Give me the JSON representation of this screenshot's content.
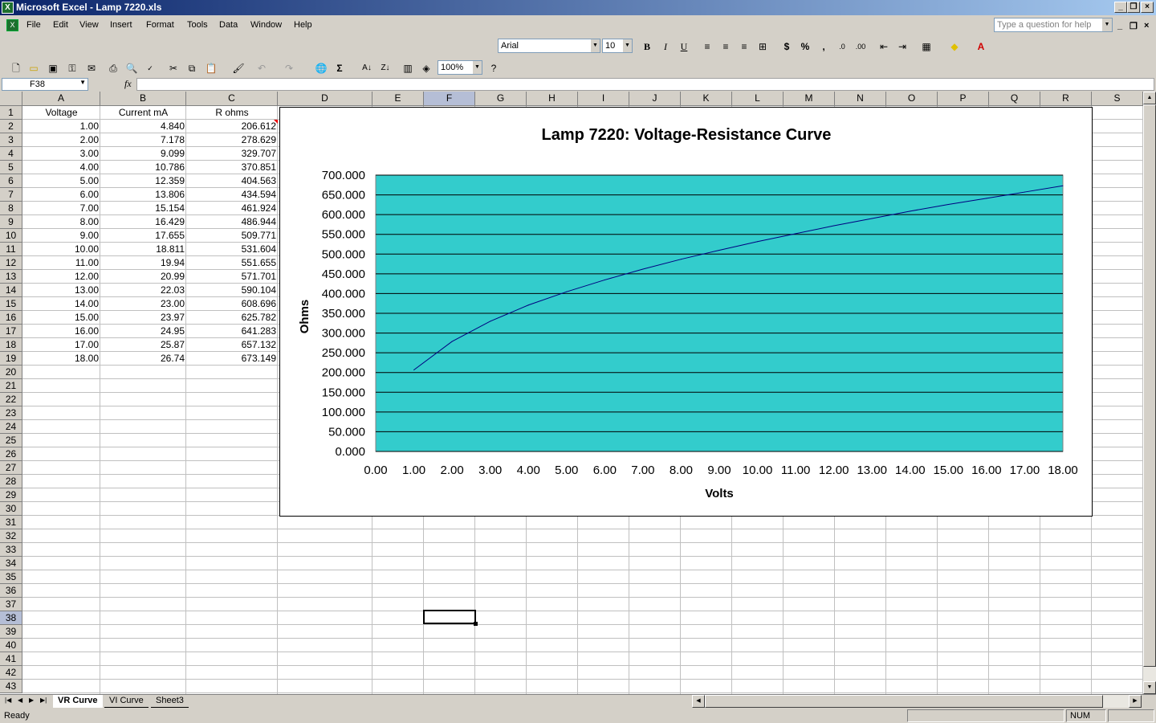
{
  "window": {
    "title": "Microsoft Excel - Lamp 7220.xls"
  },
  "menu": {
    "items": [
      "File",
      "Edit",
      "View",
      "Insert",
      "Format",
      "Tools",
      "Data",
      "Window",
      "Help"
    ],
    "help_placeholder": "Type a question for help"
  },
  "format_toolbar": {
    "font": "Arial",
    "size": "10"
  },
  "standard_toolbar": {
    "zoom": "100%"
  },
  "formula_bar": {
    "name_box": "F38",
    "fx": "fx",
    "formula": ""
  },
  "columns": [
    "A",
    "B",
    "C",
    "D",
    "E",
    "F",
    "G",
    "H",
    "I",
    "J",
    "K",
    "L",
    "M",
    "N",
    "O",
    "P",
    "Q",
    "R",
    "S"
  ],
  "selected_column": "F",
  "rows": [
    "1",
    "2",
    "3",
    "4",
    "5",
    "6",
    "7",
    "8",
    "9",
    "10",
    "11",
    "12",
    "13",
    "14",
    "15",
    "16",
    "17",
    "18",
    "19",
    "20",
    "21",
    "22",
    "23",
    "24",
    "25",
    "26",
    "27",
    "28",
    "29",
    "30",
    "31",
    "32",
    "33",
    "34",
    "35",
    "36",
    "37",
    "38",
    "39",
    "40",
    "41",
    "42",
    "43"
  ],
  "selected_row": "38",
  "table": {
    "headers": [
      "Voltage",
      "Current mA",
      "R ohms"
    ],
    "rows": [
      [
        "1.00",
        "4.840",
        "206.612"
      ],
      [
        "2.00",
        "7.178",
        "278.629"
      ],
      [
        "3.00",
        "9.099",
        "329.707"
      ],
      [
        "4.00",
        "10.786",
        "370.851"
      ],
      [
        "5.00",
        "12.359",
        "404.563"
      ],
      [
        "6.00",
        "13.806",
        "434.594"
      ],
      [
        "7.00",
        "15.154",
        "461.924"
      ],
      [
        "8.00",
        "16.429",
        "486.944"
      ],
      [
        "9.00",
        "17.655",
        "509.771"
      ],
      [
        "10.00",
        "18.811",
        "531.604"
      ],
      [
        "11.00",
        "19.94",
        "551.655"
      ],
      [
        "12.00",
        "20.99",
        "571.701"
      ],
      [
        "13.00",
        "22.03",
        "590.104"
      ],
      [
        "14.00",
        "23.00",
        "608.696"
      ],
      [
        "15.00",
        "23.97",
        "625.782"
      ],
      [
        "16.00",
        "24.95",
        "641.283"
      ],
      [
        "17.00",
        "25.87",
        "657.132"
      ],
      [
        "18.00",
        "26.74",
        "673.149"
      ]
    ]
  },
  "chart_data": {
    "type": "line",
    "title": "Lamp 7220: Voltage-Resistance Curve",
    "xlabel": "Volts",
    "ylabel": "Ohms",
    "x": [
      1,
      2,
      3,
      4,
      5,
      6,
      7,
      8,
      9,
      10,
      11,
      12,
      13,
      14,
      15,
      16,
      17,
      18
    ],
    "values": [
      206.612,
      278.629,
      329.707,
      370.851,
      404.563,
      434.594,
      461.924,
      486.944,
      509.771,
      531.604,
      551.655,
      571.701,
      590.104,
      608.696,
      625.782,
      641.283,
      657.132,
      673.149
    ],
    "xlim": [
      0,
      18
    ],
    "ylim": [
      0,
      700
    ],
    "xticks": [
      "0.00",
      "1.00",
      "2.00",
      "3.00",
      "4.00",
      "5.00",
      "6.00",
      "7.00",
      "8.00",
      "9.00",
      "10.00",
      "11.00",
      "12.00",
      "13.00",
      "14.00",
      "15.00",
      "16.00",
      "17.00",
      "18.00"
    ],
    "yticks": [
      "0.000",
      "50.000",
      "100.000",
      "150.000",
      "200.000",
      "250.000",
      "300.000",
      "350.000",
      "400.000",
      "450.000",
      "500.000",
      "550.000",
      "600.000",
      "650.000",
      "700.000"
    ],
    "grid": true,
    "plot_bg": "#33cccc",
    "line_color": "#000080"
  },
  "sheets": {
    "tabs": [
      "VR Curve",
      "VI Curve",
      "Sheet3"
    ],
    "active": "VR Curve"
  },
  "status": {
    "text": "Ready",
    "num": "NUM"
  }
}
